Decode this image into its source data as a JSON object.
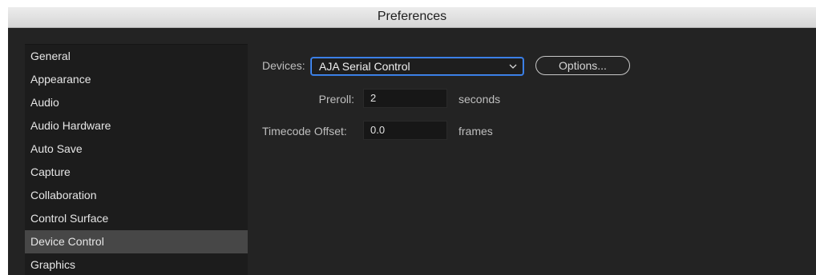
{
  "window": {
    "title": "Preferences"
  },
  "sidebar": {
    "items": [
      {
        "label": "General"
      },
      {
        "label": "Appearance"
      },
      {
        "label": "Audio"
      },
      {
        "label": "Audio Hardware"
      },
      {
        "label": "Auto Save"
      },
      {
        "label": "Capture"
      },
      {
        "label": "Collaboration"
      },
      {
        "label": "Control Surface"
      },
      {
        "label": "Device Control",
        "selected": true
      },
      {
        "label": "Graphics"
      }
    ]
  },
  "device_control": {
    "devices_label": "Devices:",
    "devices_value": "AJA Serial Control",
    "options_label": "Options...",
    "preroll_label": "Preroll:",
    "preroll_value": "2",
    "preroll_unit": "seconds",
    "timecode_label": "Timecode Offset:",
    "timecode_value": "0.0",
    "timecode_unit": "frames"
  },
  "colors": {
    "background": "#232323",
    "sidebar": "#1c1c1c",
    "selected_item": "#474747",
    "focus_ring": "#4b93ff"
  },
  "icons": {
    "dropdown": "chevron-down-icon"
  }
}
